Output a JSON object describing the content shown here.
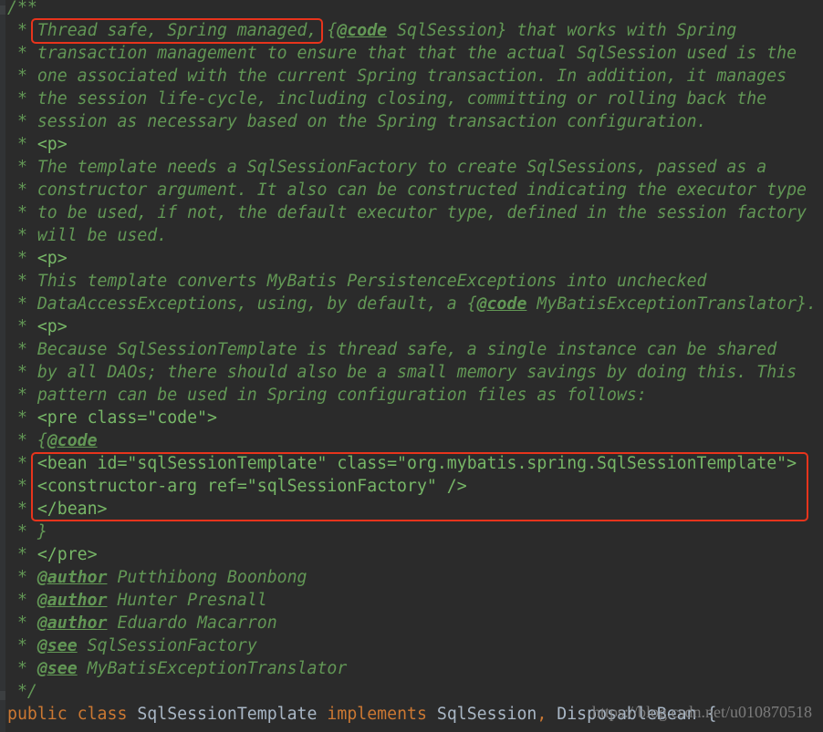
{
  "comment_open": "/**",
  "comment_close": " */",
  "lines": [
    {
      "prefix": " * ",
      "segments": [
        {
          "t": "Thread safe, Spring managed,",
          "c": "doc"
        },
        {
          "t": " {",
          "c": "doc"
        },
        {
          "t": "@code",
          "c": "doctag"
        },
        {
          "t": " SqlSession} that works with Spring",
          "c": "doc"
        }
      ]
    },
    {
      "prefix": " * ",
      "segments": [
        {
          "t": "transaction management to ensure that that the actual SqlSession used is the",
          "c": "doc"
        }
      ]
    },
    {
      "prefix": " * ",
      "segments": [
        {
          "t": "one associated with the current Spring transaction. In addition, it manages",
          "c": "doc"
        }
      ]
    },
    {
      "prefix": " * ",
      "segments": [
        {
          "t": "the session life-cycle, including closing, committing or rolling back the",
          "c": "doc"
        }
      ]
    },
    {
      "prefix": " * ",
      "segments": [
        {
          "t": "session as necessary based on the Spring transaction configuration.",
          "c": "doc"
        }
      ]
    },
    {
      "prefix": " * ",
      "segments": [
        {
          "t": "<p>",
          "c": "tag"
        }
      ]
    },
    {
      "prefix": " * ",
      "segments": [
        {
          "t": "The template needs a SqlSessionFactory to create SqlSessions, passed as a",
          "c": "doc"
        }
      ]
    },
    {
      "prefix": " * ",
      "segments": [
        {
          "t": "constructor argument. It also can be constructed indicating the executor type",
          "c": "doc"
        }
      ]
    },
    {
      "prefix": " * ",
      "segments": [
        {
          "t": "to be used, if not, the default executor type, defined in the session factory",
          "c": "doc"
        }
      ]
    },
    {
      "prefix": " * ",
      "segments": [
        {
          "t": "will be used.",
          "c": "doc"
        }
      ]
    },
    {
      "prefix": " * ",
      "segments": [
        {
          "t": "<p>",
          "c": "tag"
        }
      ]
    },
    {
      "prefix": " * ",
      "segments": [
        {
          "t": "This template converts MyBatis PersistenceExceptions into unchecked",
          "c": "doc"
        }
      ]
    },
    {
      "prefix": " * ",
      "segments": [
        {
          "t": "DataAccessExceptions, using, by default, a {",
          "c": "doc"
        },
        {
          "t": "@code",
          "c": "doctag"
        },
        {
          "t": " MyBatisExceptionTranslator}.",
          "c": "doc"
        }
      ]
    },
    {
      "prefix": " * ",
      "segments": [
        {
          "t": "<p>",
          "c": "tag"
        }
      ]
    },
    {
      "prefix": " * ",
      "segments": [
        {
          "t": "Because SqlSessionTemplate is thread safe, a single instance can be shared",
          "c": "doc"
        }
      ]
    },
    {
      "prefix": " * ",
      "segments": [
        {
          "t": "by all DAOs; there should also be a small memory savings by doing this. This",
          "c": "doc"
        }
      ]
    },
    {
      "prefix": " * ",
      "segments": [
        {
          "t": "pattern can be used in Spring configuration files as follows:",
          "c": "doc"
        }
      ]
    },
    {
      "prefix": " * ",
      "segments": [
        {
          "t": "<pre class=\"code\">",
          "c": "tag"
        }
      ]
    },
    {
      "prefix": " * ",
      "segments": [
        {
          "t": "{",
          "c": "doc"
        },
        {
          "t": "@code",
          "c": "doctag"
        }
      ]
    },
    {
      "prefix": " * ",
      "segments": [
        {
          "t": "<bean id=\"sqlSessionTemplate\" class=\"org.mybatis.spring.SqlSessionTemplate\">",
          "c": "tag"
        }
      ]
    },
    {
      "prefix": " * ",
      "segments": [
        {
          "t": "<constructor-arg ref=\"sqlSessionFactory\" />",
          "c": "tag"
        }
      ]
    },
    {
      "prefix": " * ",
      "segments": [
        {
          "t": "</bean>",
          "c": "tag"
        }
      ]
    },
    {
      "prefix": " * ",
      "segments": [
        {
          "t": "}",
          "c": "doc"
        }
      ]
    },
    {
      "prefix": " * ",
      "segments": [
        {
          "t": "</pre>",
          "c": "tag"
        }
      ]
    },
    {
      "prefix": " * ",
      "segments": [
        {
          "t": "@author",
          "c": "doctag"
        },
        {
          "t": " Putthibong Boonbong",
          "c": "doc"
        }
      ]
    },
    {
      "prefix": " * ",
      "segments": [
        {
          "t": "@author",
          "c": "doctag"
        },
        {
          "t": " Hunter Presnall",
          "c": "doc"
        }
      ]
    },
    {
      "prefix": " * ",
      "segments": [
        {
          "t": "@author",
          "c": "doctag"
        },
        {
          "t": " Eduardo Macarron",
          "c": "doc"
        }
      ]
    },
    {
      "prefix": " * ",
      "segments": [
        {
          "t": "@see",
          "c": "doctag"
        },
        {
          "t": " SqlSessionFactory",
          "c": "doc"
        }
      ]
    },
    {
      "prefix": " * ",
      "segments": [
        {
          "t": "@see",
          "c": "doctag"
        },
        {
          "t": " MyBatisExceptionTranslator",
          "c": "doc"
        }
      ]
    }
  ],
  "class_decl": {
    "kw_public": "public",
    "kw_class": "class",
    "name": "SqlSessionTemplate",
    "kw_implements": "implements",
    "iface1": "SqlSession",
    "comma": ",",
    "iface2": "DisposableBean",
    "brace": "{"
  },
  "watermark": "https://blog.csdn.net/u010870518",
  "colors": {
    "background": "#2b2b2b",
    "doc_comment": "#629755",
    "keyword": "#cc7832",
    "plain": "#a9b7c6",
    "highlight_border": "#e8341c"
  }
}
